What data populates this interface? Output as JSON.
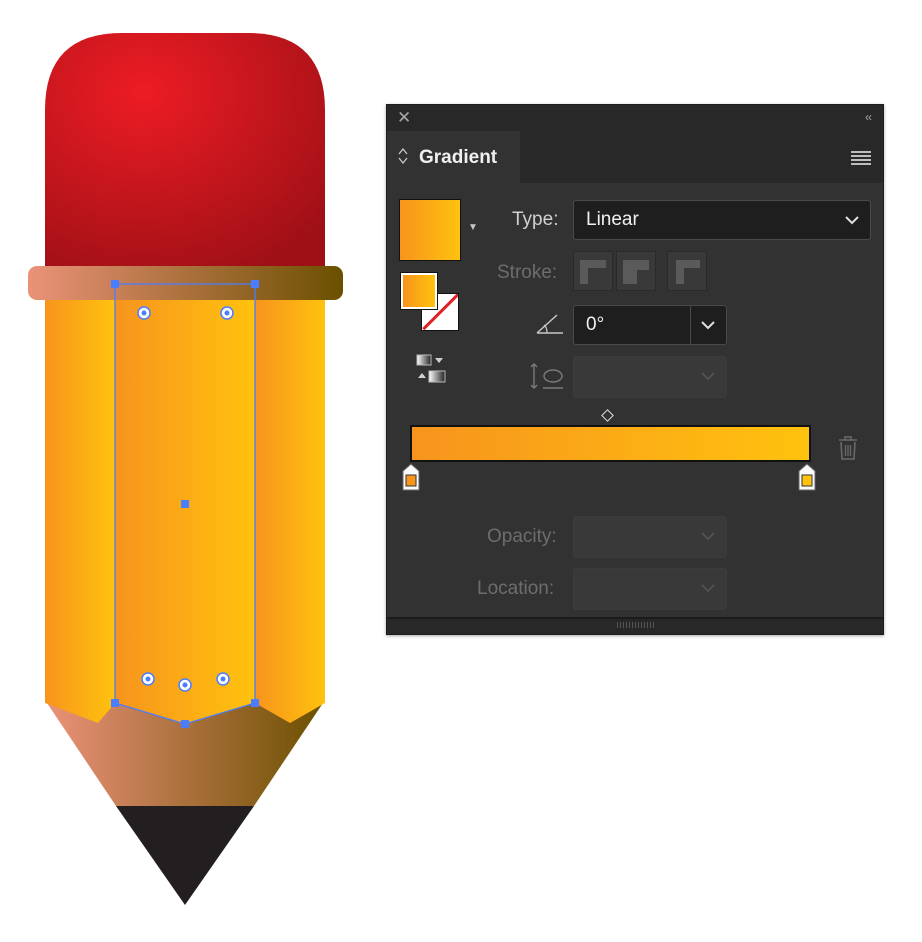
{
  "panel": {
    "close_glyph": "✕",
    "collapse_glyph": "‹‹",
    "tab_label": "Gradient",
    "type_label": "Type:",
    "type_value": "Linear",
    "stroke_label": "Stroke:",
    "angle_value": "0°",
    "opacity_label": "Opacity:",
    "location_label": "Location:",
    "gradient_colors": [
      "#F7941D",
      "#FFC20E"
    ]
  },
  "icons": [
    "close-icon",
    "collapse-icon",
    "panel-menu-icon",
    "angle-icon",
    "aspect-ratio-icon",
    "reverse-gradient-icon",
    "delete-stop-icon",
    "chevron-down-icon"
  ],
  "artwork": {
    "eraser_color": "#ED1C24",
    "ferrule_colors": [
      "#EB9279",
      "#6B5000"
    ],
    "body_colors": [
      "#F7941D",
      "#FFC20E"
    ],
    "tip_color": "#231F20"
  }
}
